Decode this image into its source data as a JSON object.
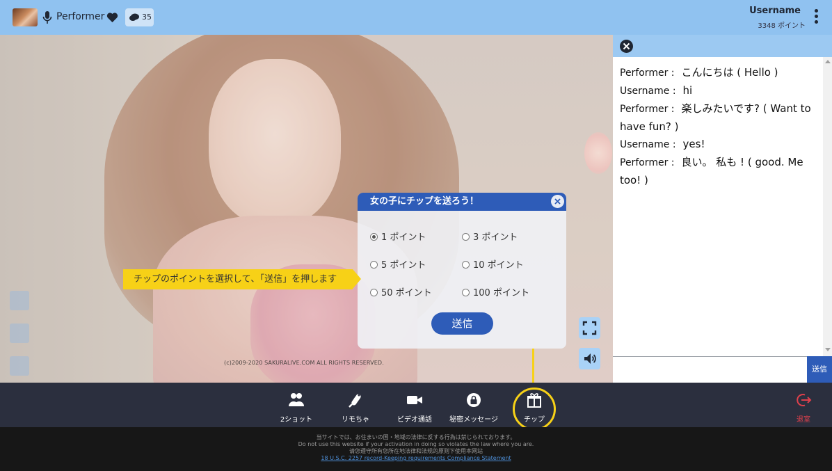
{
  "header": {
    "performer_name": "Performer",
    "viewer_count": "35",
    "username": "Username",
    "points": "3348 ポイント"
  },
  "video": {
    "copyright": "(c)2009-2020 SAKURALIVE.COM ALL RIGHTS RESERVED."
  },
  "chat": {
    "messages": [
      {
        "who": "Performer :",
        "text": "こんにちは ( Hello )"
      },
      {
        "who": "Username :",
        "text": "hi"
      },
      {
        "who": "Performer :",
        "text": "楽しみたいです? ( Want to have fun? )"
      },
      {
        "who": "Username :",
        "text": "yes!"
      },
      {
        "who": "Performer :",
        "text": "良い。 私も ! ( good. Me too! )"
      }
    ],
    "send_label": "送信"
  },
  "tip_dialog": {
    "title": "女の子にチップを送ろう！",
    "options": [
      "1 ポイント",
      "3 ポイント",
      "5 ポイント",
      "10 ポイント",
      "50 ポイント",
      "100 ポイント"
    ],
    "selected": "1 ポイント",
    "send_label": "送信"
  },
  "hint": "チップのポイントを選択して､「送信」を押します",
  "toolbar": {
    "two_shot": "2ショット",
    "remote_toy": "リモちゃ",
    "video_call": "ビデオ通話",
    "secret_message": "秘密メッセージ",
    "tip": "チップ",
    "exit": "退室"
  },
  "footer": {
    "line1": "当サイトでは、お住まいの国・地域の法律に反する行為は禁じられております。",
    "line2": "Do not use this website if your activation in doing so violates the law where you are.",
    "line3": "请您遵守所有您所在地法律和法规的原则下使用本网站",
    "link": "18 U.S.C. 2257 record-Keeping requirements Compliance Statement"
  },
  "colors": {
    "header_bg": "#90c2f0",
    "accent_blue": "#2e5cb8",
    "highlight_yellow": "#f7d117",
    "toolbar_bg": "#2b2f3e",
    "exit_red": "#e0404c"
  }
}
